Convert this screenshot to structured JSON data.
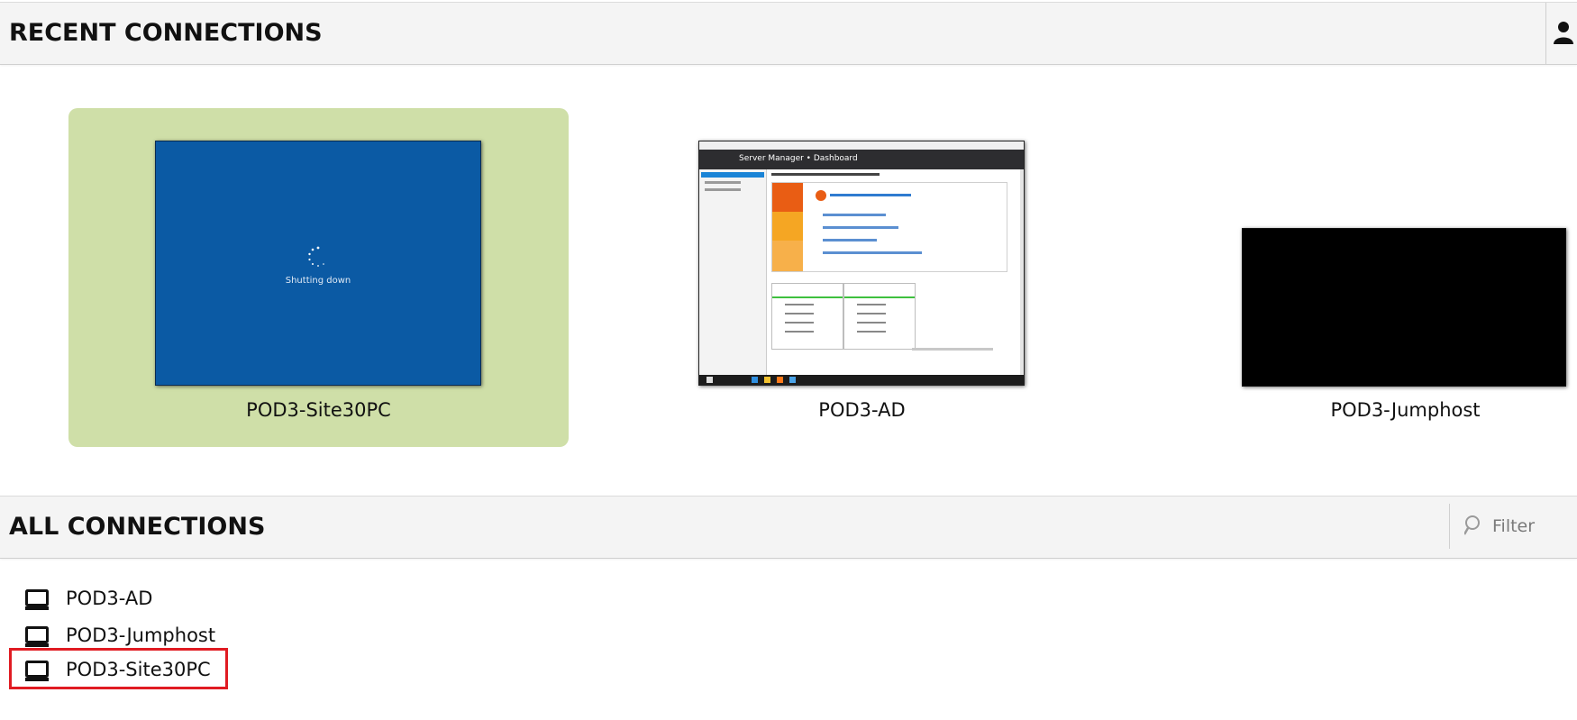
{
  "recent": {
    "title": "RECENT CONNECTIONS",
    "cards": [
      {
        "name": "POD3-Site30PC",
        "active": true,
        "thumbnail_text": "Shutting down"
      },
      {
        "name": "POD3-AD",
        "active": false,
        "thumbnail_text": "Server Manager • Dashboard"
      },
      {
        "name": "POD3-Jumphost",
        "active": false
      }
    ]
  },
  "all": {
    "title": "ALL CONNECTIONS",
    "filter_placeholder": "Filter",
    "items": [
      {
        "name": "POD3-AD",
        "selected": false
      },
      {
        "name": "POD3-Jumphost",
        "selected": false
      },
      {
        "name": "POD3-Site30PC",
        "selected": true
      }
    ]
  },
  "icons": {
    "user_menu": "user-icon",
    "filter": "search-icon",
    "connection": "monitor-icon"
  },
  "colors": {
    "active_card": "#cfdfa8",
    "selection_outline": "#e01b22",
    "shutdown_bg": "#0b5aa4"
  }
}
